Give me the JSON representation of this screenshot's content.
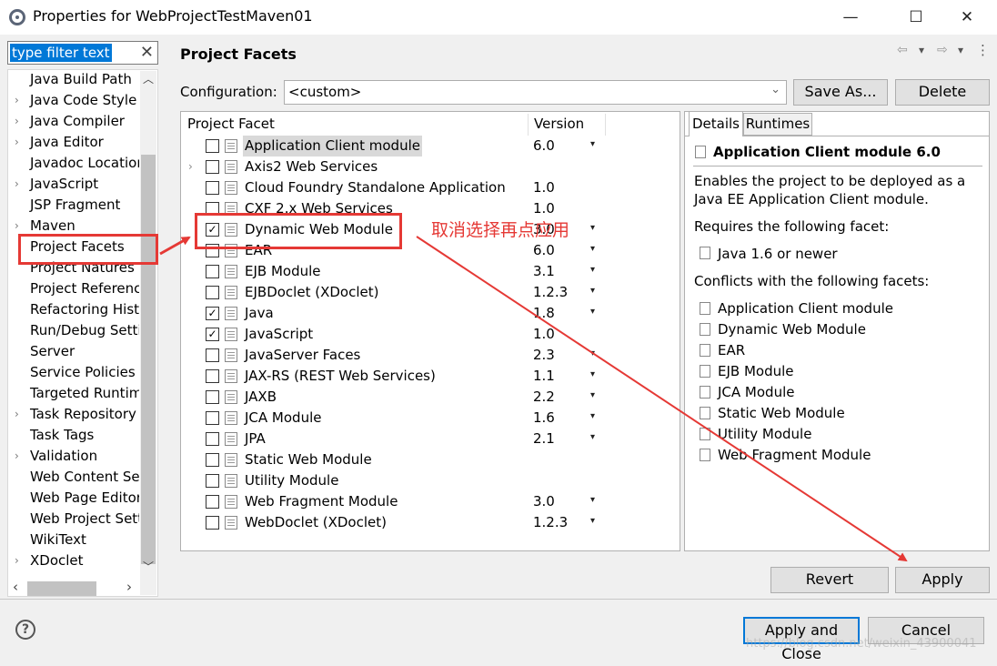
{
  "window": {
    "title": "Properties for WebProjectTestMaven01",
    "minimize_glyph": "—",
    "maximize_glyph": "☐",
    "close_glyph": "✕"
  },
  "filter": {
    "value": "type filter text",
    "clear_glyph": "✕"
  },
  "nav": {
    "items": [
      {
        "label": "Java Build Path",
        "arrow": ""
      },
      {
        "label": "Java Code Style",
        "arrow": "›"
      },
      {
        "label": "Java Compiler",
        "arrow": "›"
      },
      {
        "label": "Java Editor",
        "arrow": "›"
      },
      {
        "label": "Javadoc Location",
        "arrow": ""
      },
      {
        "label": "JavaScript",
        "arrow": "›"
      },
      {
        "label": "JSP Fragment",
        "arrow": ""
      },
      {
        "label": "Maven",
        "arrow": "›"
      },
      {
        "label": "Project Facets",
        "arrow": ""
      },
      {
        "label": "Project Natures",
        "arrow": ""
      },
      {
        "label": "Project References",
        "arrow": ""
      },
      {
        "label": "Refactoring History",
        "arrow": ""
      },
      {
        "label": "Run/Debug Settings",
        "arrow": ""
      },
      {
        "label": "Server",
        "arrow": ""
      },
      {
        "label": "Service Policies",
        "arrow": ""
      },
      {
        "label": "Targeted Runtimes",
        "arrow": ""
      },
      {
        "label": "Task Repository",
        "arrow": "›"
      },
      {
        "label": "Task Tags",
        "arrow": ""
      },
      {
        "label": "Validation",
        "arrow": "›"
      },
      {
        "label": "Web Content Settings",
        "arrow": ""
      },
      {
        "label": "Web Page Editor",
        "arrow": ""
      },
      {
        "label": "Web Project Settings",
        "arrow": ""
      },
      {
        "label": "WikiText",
        "arrow": ""
      },
      {
        "label": "XDoclet",
        "arrow": "›"
      }
    ],
    "scroll_up_glyph": "︿",
    "scroll_down_glyph": "﹀",
    "scroll_left_glyph": "‹",
    "scroll_right_glyph": "›"
  },
  "pane": {
    "title": "Project Facets",
    "nav_glyphs": {
      "back": "⇦",
      "back_menu": "▾",
      "forward": "⇨",
      "forward_menu": "▾",
      "more": "⋮"
    },
    "config_label": "Configuration:",
    "config_value": "<custom>",
    "config_chevron": "⌄",
    "save_as_label": "Save As...",
    "delete_label": "Delete"
  },
  "facets": {
    "headers": {
      "name": "Project Facet",
      "version": "Version"
    },
    "rows": [
      {
        "name": "Application Client module",
        "version": "6.0",
        "dropdown": true,
        "checked": false,
        "expand": "",
        "selected": true
      },
      {
        "name": "Axis2 Web Services",
        "version": "",
        "dropdown": false,
        "checked": false,
        "expand": "›",
        "selected": false
      },
      {
        "name": "Cloud Foundry Standalone Application",
        "version": "1.0",
        "dropdown": false,
        "checked": false,
        "expand": "",
        "selected": false
      },
      {
        "name": "CXF 2.x Web Services",
        "version": "1.0",
        "dropdown": false,
        "checked": false,
        "expand": "",
        "selected": false
      },
      {
        "name": "Dynamic Web Module",
        "version": "3.0",
        "dropdown": true,
        "checked": true,
        "expand": "",
        "selected": false
      },
      {
        "name": "EAR",
        "version": "6.0",
        "dropdown": true,
        "checked": false,
        "expand": "",
        "selected": false
      },
      {
        "name": "EJB Module",
        "version": "3.1",
        "dropdown": true,
        "checked": false,
        "expand": "",
        "selected": false
      },
      {
        "name": "EJBDoclet (XDoclet)",
        "version": "1.2.3",
        "dropdown": true,
        "checked": false,
        "expand": "",
        "selected": false
      },
      {
        "name": "Java",
        "version": "1.8",
        "dropdown": true,
        "checked": true,
        "expand": "",
        "selected": false
      },
      {
        "name": "JavaScript",
        "version": "1.0",
        "dropdown": false,
        "checked": true,
        "expand": "",
        "selected": false
      },
      {
        "name": "JavaServer Faces",
        "version": "2.3",
        "dropdown": true,
        "checked": false,
        "expand": "",
        "selected": false
      },
      {
        "name": "JAX-RS (REST Web Services)",
        "version": "1.1",
        "dropdown": true,
        "checked": false,
        "expand": "",
        "selected": false
      },
      {
        "name": "JAXB",
        "version": "2.2",
        "dropdown": true,
        "checked": false,
        "expand": "",
        "selected": false
      },
      {
        "name": "JCA Module",
        "version": "1.6",
        "dropdown": true,
        "checked": false,
        "expand": "",
        "selected": false
      },
      {
        "name": "JPA",
        "version": "2.1",
        "dropdown": true,
        "checked": false,
        "expand": "",
        "selected": false
      },
      {
        "name": "Static Web Module",
        "version": "",
        "dropdown": false,
        "checked": false,
        "expand": "",
        "selected": false
      },
      {
        "name": "Utility Module",
        "version": "",
        "dropdown": false,
        "checked": false,
        "expand": "",
        "selected": false
      },
      {
        "name": "Web Fragment Module",
        "version": "3.0",
        "dropdown": true,
        "checked": false,
        "expand": "",
        "selected": false
      },
      {
        "name": "WebDoclet (XDoclet)",
        "version": "1.2.3",
        "dropdown": true,
        "checked": false,
        "expand": "",
        "selected": false
      }
    ],
    "dropdown_glyph": "▾",
    "check_glyph": "✓"
  },
  "details": {
    "tab_details": "Details",
    "tab_runtimes": "Runtimes",
    "heading": "Application Client module 6.0",
    "description_line1": "Enables the project to be deployed as a",
    "description_line2": "Java EE Application Client module.",
    "requires_label": "Requires the following facet:",
    "requires_item": "Java 1.6 or newer",
    "conflicts_label": "Conflicts with the following facets:",
    "conflicts": [
      "Application Client module",
      "Dynamic Web Module",
      "EAR",
      "EJB Module",
      "JCA Module",
      "Static Web Module",
      "Utility Module",
      "Web Fragment Module"
    ]
  },
  "buttons": {
    "revert": "Revert",
    "apply": "Apply",
    "apply_and_close": "Apply and Close",
    "cancel": "Cancel",
    "help_glyph": "?"
  },
  "annotation": {
    "text": "取消选择再点应用",
    "color": "#e53935"
  },
  "watermark": "https://blog.csdn.net/weixin_43900041"
}
